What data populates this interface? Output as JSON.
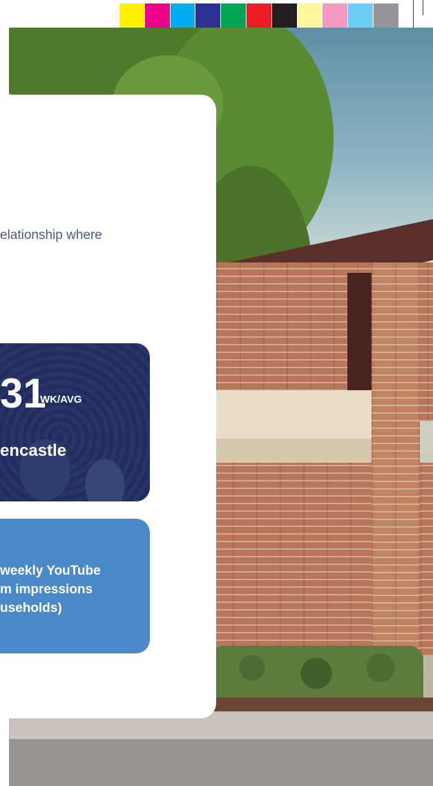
{
  "print_marks": {
    "color_swatches": [
      "#fff200",
      "#ec008c",
      "#00aeef",
      "#2e3192",
      "#00a651",
      "#ed1c24",
      "#231f20",
      "#fff799",
      "#f49ac1",
      "#6dcff6",
      "#939598"
    ]
  },
  "card": {
    "intro_text": "elationship where"
  },
  "attendance": {
    "number": "31",
    "unit": "WK/AVG",
    "location": "encastle"
  },
  "youtube": {
    "line1": "weekly YouTube",
    "line2": "m impressions",
    "line3": "useholds)"
  },
  "colors": {
    "card_background": "#ffffff",
    "stat_box_blue": "#2f3c74",
    "youtube_box_blue": "#4a88c8",
    "intro_text": "#4a5a8a"
  }
}
